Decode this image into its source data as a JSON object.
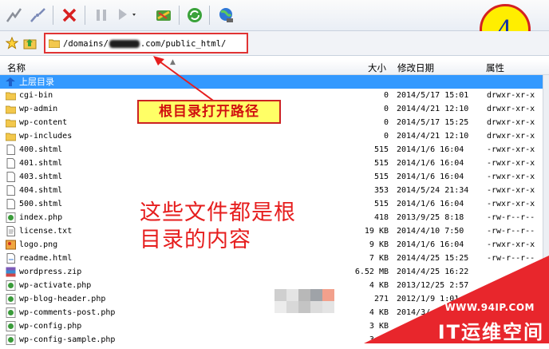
{
  "toolbar": {
    "buttons": [
      "connect-icon",
      "disconnect-icon",
      "stop-icon",
      "pause-icon",
      "play-icon",
      "transfer-icon",
      "refresh-icon",
      "globe-icon"
    ]
  },
  "address": {
    "path_prefix": "/domains/",
    "path_suffix": ".com/public_html/"
  },
  "step_marker": "4",
  "columns": {
    "name": "名称",
    "size": "大小",
    "modified": "修改日期",
    "attributes": "属性"
  },
  "files": [
    {
      "name": "上层目录",
      "size": "",
      "date": "",
      "perm": "",
      "icon": "parent-up-icon",
      "selected": true
    },
    {
      "name": "cgi-bin",
      "size": "0",
      "date": "2014/5/17 15:01",
      "perm": "drwxr-xr-x",
      "icon": "folder-icon"
    },
    {
      "name": "wp-admin",
      "size": "0",
      "date": "2014/4/21 12:10",
      "perm": "drwxr-xr-x",
      "icon": "folder-icon"
    },
    {
      "name": "wp-content",
      "size": "0",
      "date": "2014/5/17 15:25",
      "perm": "drwxr-xr-x",
      "icon": "folder-icon"
    },
    {
      "name": "wp-includes",
      "size": "0",
      "date": "2014/4/21 12:10",
      "perm": "drwxr-xr-x",
      "icon": "folder-icon"
    },
    {
      "name": "400.shtml",
      "size": "515",
      "date": "2014/1/6 16:04",
      "perm": "-rwxr-xr-x",
      "icon": "file-icon"
    },
    {
      "name": "401.shtml",
      "size": "515",
      "date": "2014/1/6 16:04",
      "perm": "-rwxr-xr-x",
      "icon": "file-icon"
    },
    {
      "name": "403.shtml",
      "size": "515",
      "date": "2014/1/6 16:04",
      "perm": "-rwxr-xr-x",
      "icon": "file-icon"
    },
    {
      "name": "404.shtml",
      "size": "353",
      "date": "2014/5/24 21:34",
      "perm": "-rwxr-xr-x",
      "icon": "file-icon"
    },
    {
      "name": "500.shtml",
      "size": "515",
      "date": "2014/1/6 16:04",
      "perm": "-rwxr-xr-x",
      "icon": "file-icon"
    },
    {
      "name": "index.php",
      "size": "418",
      "date": "2013/9/25 8:18",
      "perm": "-rw-r--r--",
      "icon": "php-file-icon"
    },
    {
      "name": "license.txt",
      "size": "19 KB",
      "date": "2014/4/10 7:50",
      "perm": "-rw-r--r--",
      "icon": "text-file-icon"
    },
    {
      "name": "logo.png",
      "size": "9 KB",
      "date": "2014/1/6 16:04",
      "perm": "-rwxr-xr-x",
      "icon": "image-file-icon"
    },
    {
      "name": "readme.html",
      "size": "7 KB",
      "date": "2014/4/25 15:25",
      "perm": "-rw-r--r--",
      "icon": "html-file-icon"
    },
    {
      "name": "wordpress.zip",
      "size": "6.52 MB",
      "date": "2014/4/25 16:22",
      "perm": "",
      "icon": "zip-file-icon"
    },
    {
      "name": "wp-activate.php",
      "size": "4 KB",
      "date": "2013/12/25 2:57",
      "perm": "",
      "icon": "php-file-icon"
    },
    {
      "name": "wp-blog-header.php",
      "size": "271",
      "date": "2012/1/9 1:01",
      "perm": "",
      "icon": "php-file-icon"
    },
    {
      "name": "wp-comments-post.php",
      "size": "4 KB",
      "date": "2014/3/",
      "perm": "",
      "icon": "php-file-icon"
    },
    {
      "name": "wp-config.php",
      "size": "3 KB",
      "date": "",
      "perm": "",
      "icon": "php-file-icon"
    },
    {
      "name": "wp-config-sample.php",
      "size": "3 KB",
      "date": "",
      "perm": "",
      "icon": "php-file-icon"
    }
  ],
  "annotations": {
    "root_path_label": "根目录打开路径",
    "contents_label_line1": "这些文件都是根",
    "contents_label_line2": "目录的内容"
  },
  "watermark": {
    "url": "WWW.94IP.COM",
    "title": "IT运维空间"
  },
  "colors": {
    "annotation_red": "#e61e1e",
    "selection_blue": "#3399ff",
    "marker_yellow": "#ffee00",
    "badge_red": "#e8262c"
  }
}
